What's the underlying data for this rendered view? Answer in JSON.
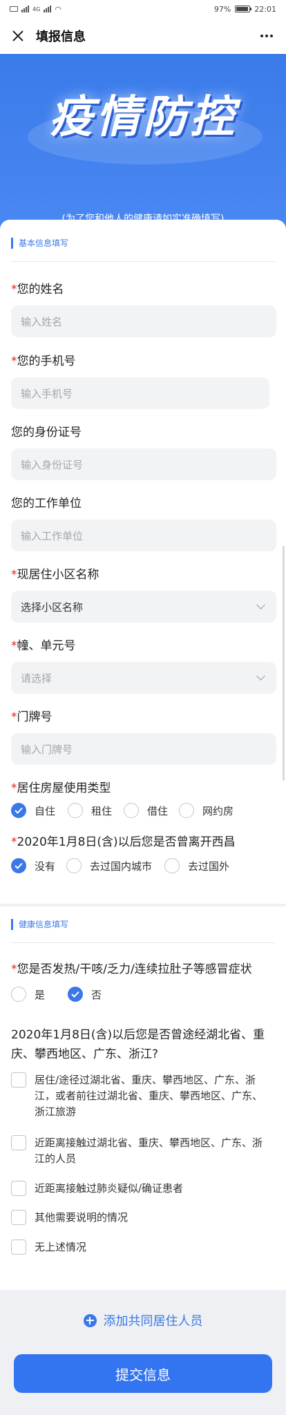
{
  "status": {
    "battery": "97%",
    "time": "22:01",
    "network": "4G"
  },
  "nav": {
    "title": "填报信息"
  },
  "banner": {
    "title": "疫情防控",
    "subtitle": "(为了您和他人的健康请如实准确填写)"
  },
  "section1": {
    "heading": "基本信息填写"
  },
  "fields": [
    {
      "label": "您的姓名",
      "required": "*",
      "placeholder": "输入姓名"
    },
    {
      "label": "您的手机号",
      "required": "*",
      "placeholder": "输入手机号"
    },
    {
      "label": "您的身份证号",
      "required": "",
      "placeholder": "输入身份证号"
    },
    {
      "label": "您的工作单位",
      "required": "",
      "placeholder": "输入工作单位"
    },
    {
      "label": "现居住小区名称",
      "required": "*",
      "placeholder": "选择小区名称"
    },
    {
      "label": "幢、单元号",
      "required": "*",
      "placeholder": "请选择"
    },
    {
      "label": "门牌号",
      "required": "*",
      "placeholder": "输入门牌号"
    }
  ],
  "housing": {
    "required": "*",
    "label": "居住房屋使用类型",
    "options": [
      "自住",
      "租住",
      "借住",
      "网约房"
    ],
    "selected": 0
  },
  "left_xichang": {
    "required": "*",
    "label": "2020年1月8日(含)以后您是否曾离开西昌",
    "options": [
      "没有",
      "去过国内城市",
      "去过国外"
    ],
    "selected": 0
  },
  "section2": {
    "heading": "健康信息填写"
  },
  "symptoms": {
    "required": "*",
    "label": "您是否发热/干咳/乏力/连续拉肚子等感冒症状",
    "options": [
      "是",
      "否"
    ],
    "selected": 1
  },
  "travel": {
    "label": "2020年1月8日(含)以后您是否曾途经湖北省、重庆、攀西地区、广东、浙江?",
    "options": [
      "居住/途径过湖北省、重庆、攀西地区、广东、浙江，或者前往过湖北省、重庆、攀西地区、广东、浙江旅游",
      "近距离接触过湖北省、重庆、攀西地区、广东、浙江的人员",
      "近距离接触过肺炎疑似/确证患者",
      "其他需要说明的情况",
      "无上述情况"
    ]
  },
  "actions": {
    "add_label": "添加共同居住人员",
    "submit_label": "提交信息"
  },
  "colors": {
    "accent": "#3b78e7",
    "banner": "#3a7bea",
    "required": "#e02020"
  }
}
